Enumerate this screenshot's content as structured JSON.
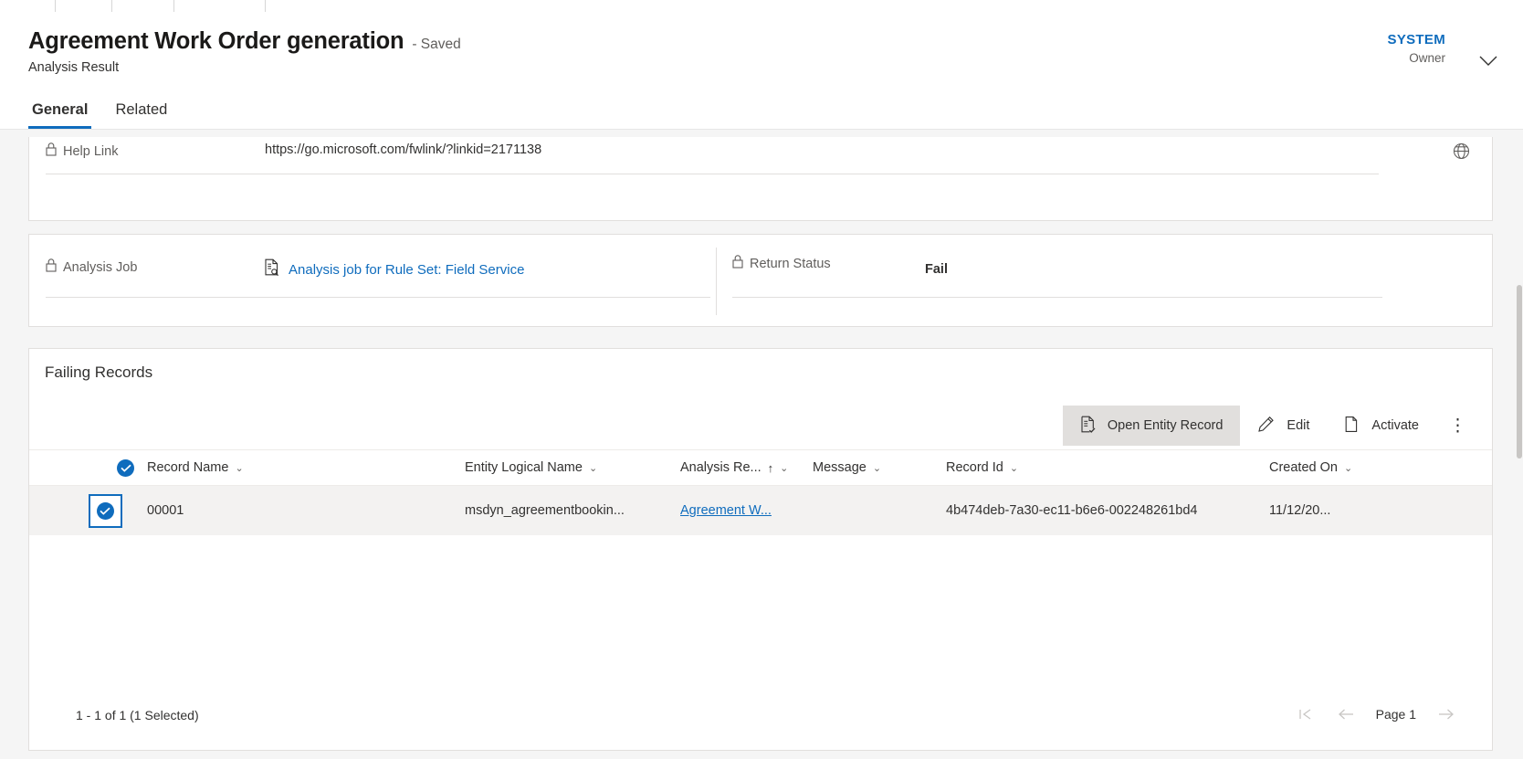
{
  "window": {
    "tab_dividers": [
      60,
      122,
      190,
      290
    ]
  },
  "header": {
    "title": "Agreement Work Order generation",
    "saved_state": "- Saved",
    "entity_name": "Analysis Result",
    "owner_name": "SYSTEM",
    "owner_role": "Owner",
    "chevron_icon": "chevron-down-icon",
    "tabs": [
      {
        "label": "General",
        "active": true
      },
      {
        "label": "Related",
        "active": false
      }
    ]
  },
  "help_link_section": {
    "label": "Help Link",
    "label_icon": "lock-icon",
    "value": "https://go.microsoft.com/fwlink/?linkid=2171138",
    "trailing_icon": "globe-icon"
  },
  "job_section": {
    "analysis_job": {
      "label": "Analysis Job",
      "label_icon": "lock-icon",
      "value_icon": "document-search-icon",
      "value": "Analysis job for Rule Set: Field Service"
    },
    "return_status": {
      "label": "Return Status",
      "label_icon": "lock-icon",
      "value": "Fail"
    }
  },
  "failing_records": {
    "title": "Failing Records",
    "commands": [
      {
        "label": "Open Entity Record",
        "icon": "open-record-icon",
        "hovered": true
      },
      {
        "label": "Edit",
        "icon": "pencil-icon",
        "hovered": false
      },
      {
        "label": "Activate",
        "icon": "page-copy-icon",
        "hovered": false
      }
    ],
    "overflow_label": "⋮",
    "columns": [
      {
        "label": "Record Name",
        "sorted": false
      },
      {
        "label": "Entity Logical Name",
        "sorted": false
      },
      {
        "label": "Analysis Re...",
        "sorted": true,
        "sort_direction": "↑"
      },
      {
        "label": "Message",
        "sorted": false
      },
      {
        "label": "Record Id",
        "sorted": false
      },
      {
        "label": "Created On",
        "sorted": false
      }
    ],
    "rows": [
      {
        "selected": true,
        "record_name": "00001",
        "entity_logical_name": "msdyn_agreementbookin...",
        "analysis_result": "Agreement W...",
        "message": "",
        "record_id": "4b474deb-7a30-ec11-b6e6-002248261bd4",
        "created_on": "11/12/20..."
      }
    ],
    "footer": {
      "count_text": "1 - 1 of 1 (1 Selected)",
      "page_label": "Page 1",
      "first_page_icon": "first-page-icon",
      "previous_icon": "arrow-left-icon",
      "next_icon": "arrow-right-icon"
    }
  },
  "colors": {
    "accent": "#0f6cbd",
    "row_selected_bg": "#f3f2f1",
    "command_hover_bg": "#e1dfdd"
  }
}
